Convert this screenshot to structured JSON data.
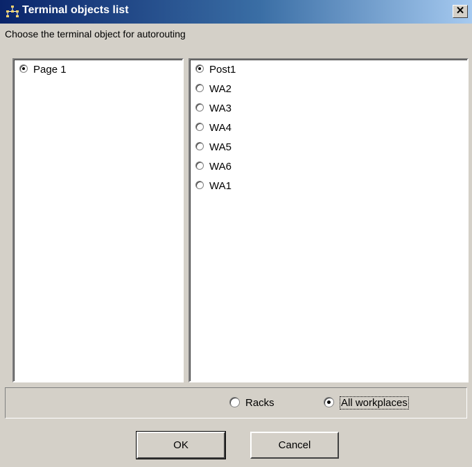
{
  "window": {
    "title": "Terminal objects list",
    "close_glyph": "✕",
    "icon": "network-icon"
  },
  "prompt": "Choose the terminal object for autorouting",
  "pages": [
    {
      "label": "Page 1",
      "selected": true
    }
  ],
  "objects": [
    {
      "label": "Post1",
      "selected": true
    },
    {
      "label": "WA2",
      "selected": false
    },
    {
      "label": "WA3",
      "selected": false
    },
    {
      "label": "WA4",
      "selected": false
    },
    {
      "label": "WA5",
      "selected": false
    },
    {
      "label": "WA6",
      "selected": false
    },
    {
      "label": "WA1",
      "selected": false
    }
  ],
  "filter": {
    "racks_label": "Racks",
    "all_label": "All workplaces",
    "selected": "All workplaces"
  },
  "buttons": {
    "ok": "OK",
    "cancel": "Cancel"
  }
}
